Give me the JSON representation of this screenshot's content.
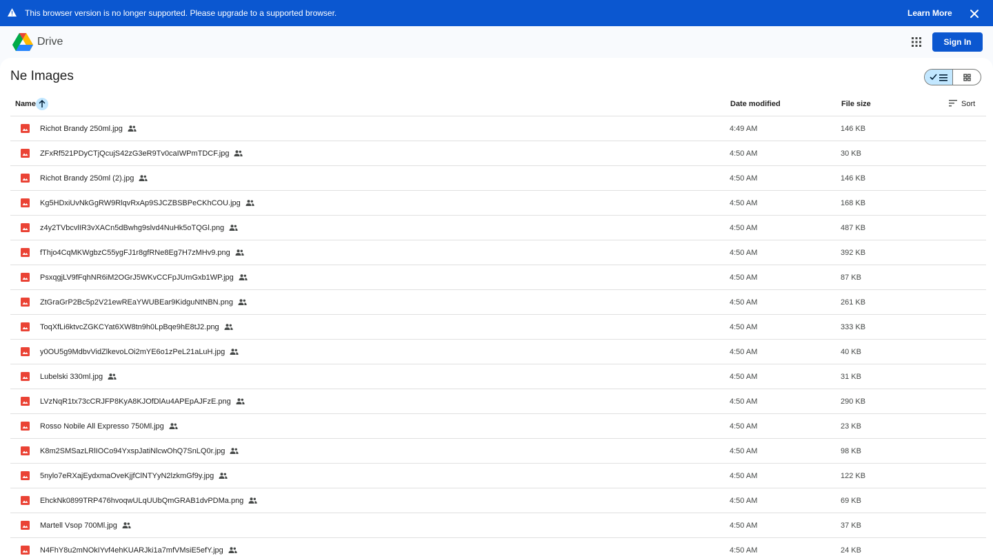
{
  "banner": {
    "message": "This browser version is no longer supported. Please upgrade to a supported browser.",
    "learn_more": "Learn More",
    "icon": "warning-icon",
    "close_icon": "close-icon"
  },
  "topbar": {
    "brand": "Drive",
    "apps_icon": "apps-grid-icon",
    "sign_in": "Sign In"
  },
  "folder": {
    "title": "Ne Images"
  },
  "view_toggle": {
    "selected": "list",
    "options": [
      "list",
      "grid"
    ]
  },
  "columns": {
    "name": "Name",
    "date_modified": "Date modified",
    "file_size": "File size",
    "sort": "Sort"
  },
  "colors": {
    "accent": "#0b57d0",
    "selected_bg": "#c2e7ff",
    "image_icon": "#ea4335"
  },
  "files": [
    {
      "name": "Richot Brandy 250ml.jpg",
      "date": "4:49 AM",
      "size": "146 KB"
    },
    {
      "name": "ZFxRf521PDyCTjQcujS42zG3eR9Tv0caIWPmTDCF.jpg",
      "date": "4:50 AM",
      "size": "30 KB"
    },
    {
      "name": "Richot Brandy 250ml (2).jpg",
      "date": "4:50 AM",
      "size": "146 KB"
    },
    {
      "name": "Kg5HDxiUvNkGgRW9RlqvRxAp9SJCZBSBPeCKhCOU.jpg",
      "date": "4:50 AM",
      "size": "168 KB"
    },
    {
      "name": "z4y2TVbcvlIR3vXACn5dBwhg9slvd4NuHk5oTQGl.png",
      "date": "4:50 AM",
      "size": "487 KB"
    },
    {
      "name": "fThjo4CqMKWgbzC55ygFJ1r8gfRNe8Eg7H7zMHv9.png",
      "date": "4:50 AM",
      "size": "392 KB"
    },
    {
      "name": "PsxqgjLV9fFqhNR6iM2OGrJ5WKvCCFpJUmGxb1WP.jpg",
      "date": "4:50 AM",
      "size": "87 KB"
    },
    {
      "name": "ZtGraGrP2Bc5p2V21ewREaYWUBEar9KidguNtNBN.png",
      "date": "4:50 AM",
      "size": "261 KB"
    },
    {
      "name": "ToqXfLi6ktvcZGKCYat6XW8tn9h0LpBqe9hE8tJ2.png",
      "date": "4:50 AM",
      "size": "333 KB"
    },
    {
      "name": "y0OU5g9MdbvVidZlkevoLOi2mYE6o1zPeL21aLuH.jpg",
      "date": "4:50 AM",
      "size": "40 KB"
    },
    {
      "name": "Lubelski 330ml.jpg",
      "date": "4:50 AM",
      "size": "31 KB"
    },
    {
      "name": "LVzNqR1tx73cCRJFP8KyA8KJOfDlAu4APEpAJFzE.png",
      "date": "4:50 AM",
      "size": "290 KB"
    },
    {
      "name": "Rosso Nobile All Expresso 750Ml.jpg",
      "date": "4:50 AM",
      "size": "23 KB"
    },
    {
      "name": "K8m2SMSazLRlIOCo94YxspJatiNlcwOhQ7SnLQ0r.jpg",
      "date": "4:50 AM",
      "size": "98 KB"
    },
    {
      "name": "5nylo7eRXajEydxmaOveKjjfClNTYyN2lzkmGf9y.jpg",
      "date": "4:50 AM",
      "size": "122 KB"
    },
    {
      "name": "EhckNk0899TRP476hvoqwULqUUbQmGRAB1dvPDMa.png",
      "date": "4:50 AM",
      "size": "69 KB"
    },
    {
      "name": "Martell Vsop 700Ml.jpg",
      "date": "4:50 AM",
      "size": "37 KB"
    },
    {
      "name": "N4FhY8u2mNOkIYvf4ehKUARJki1a7mfVMsiE5efY.jpg",
      "date": "4:50 AM",
      "size": "24 KB"
    }
  ]
}
